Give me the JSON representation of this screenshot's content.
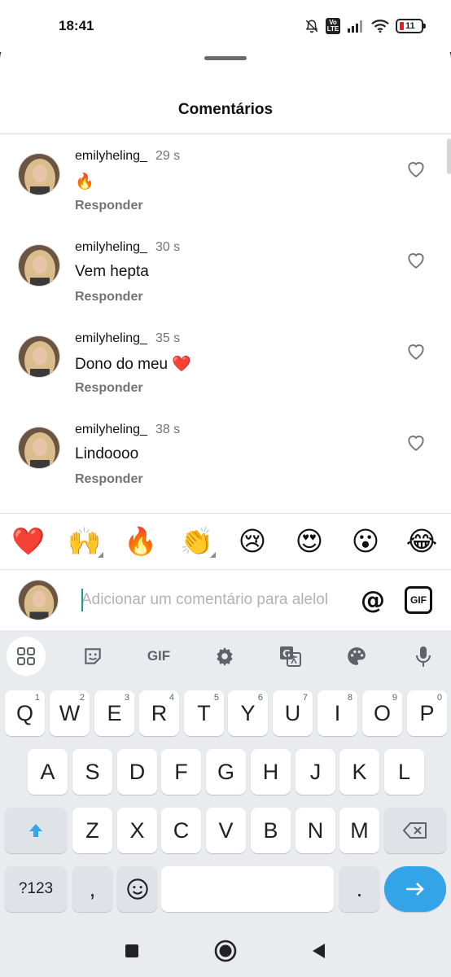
{
  "status": {
    "time": "18:41",
    "volte": "Vo LTE",
    "battery": "11"
  },
  "sheet": {
    "title": "Comentários"
  },
  "comments": [
    {
      "user": "emilyheling_",
      "time": "29 s",
      "text": "🔥",
      "reply": "Responder"
    },
    {
      "user": "emilyheling_",
      "time": "30 s",
      "text": "Vem hepta",
      "reply": "Responder"
    },
    {
      "user": "emilyheling_",
      "time": "35 s",
      "text": "Dono do meu ❤️",
      "reply": "Responder"
    },
    {
      "user": "emilyheling_",
      "time": "38 s",
      "text": "Lindoooo",
      "reply": "Responder"
    }
  ],
  "reactions": [
    "❤️",
    "🙌",
    "🔥",
    "👏",
    "😢",
    "😍",
    "😮",
    "😂"
  ],
  "composer": {
    "placeholder": "Adicionar um comentário para alelol",
    "at_label": "@",
    "gif_label": "GIF"
  },
  "keyboard": {
    "toolbar_gif": "GIF",
    "row1": [
      {
        "k": "Q",
        "h": "1"
      },
      {
        "k": "W",
        "h": "2"
      },
      {
        "k": "E",
        "h": "3"
      },
      {
        "k": "R",
        "h": "4"
      },
      {
        "k": "T",
        "h": "5"
      },
      {
        "k": "Y",
        "h": "6"
      },
      {
        "k": "U",
        "h": "7"
      },
      {
        "k": "I",
        "h": "8"
      },
      {
        "k": "O",
        "h": "9"
      },
      {
        "k": "P",
        "h": "0"
      }
    ],
    "row2": [
      "A",
      "S",
      "D",
      "F",
      "G",
      "H",
      "J",
      "K",
      "L"
    ],
    "row3": [
      "Z",
      "X",
      "C",
      "V",
      "B",
      "N",
      "M"
    ],
    "symbols_label": "?123",
    "comma_label": ",",
    "period_label": "."
  },
  "colors": {
    "accent": "#33a4e7",
    "cursor": "#14a085",
    "muted": "#737373"
  }
}
